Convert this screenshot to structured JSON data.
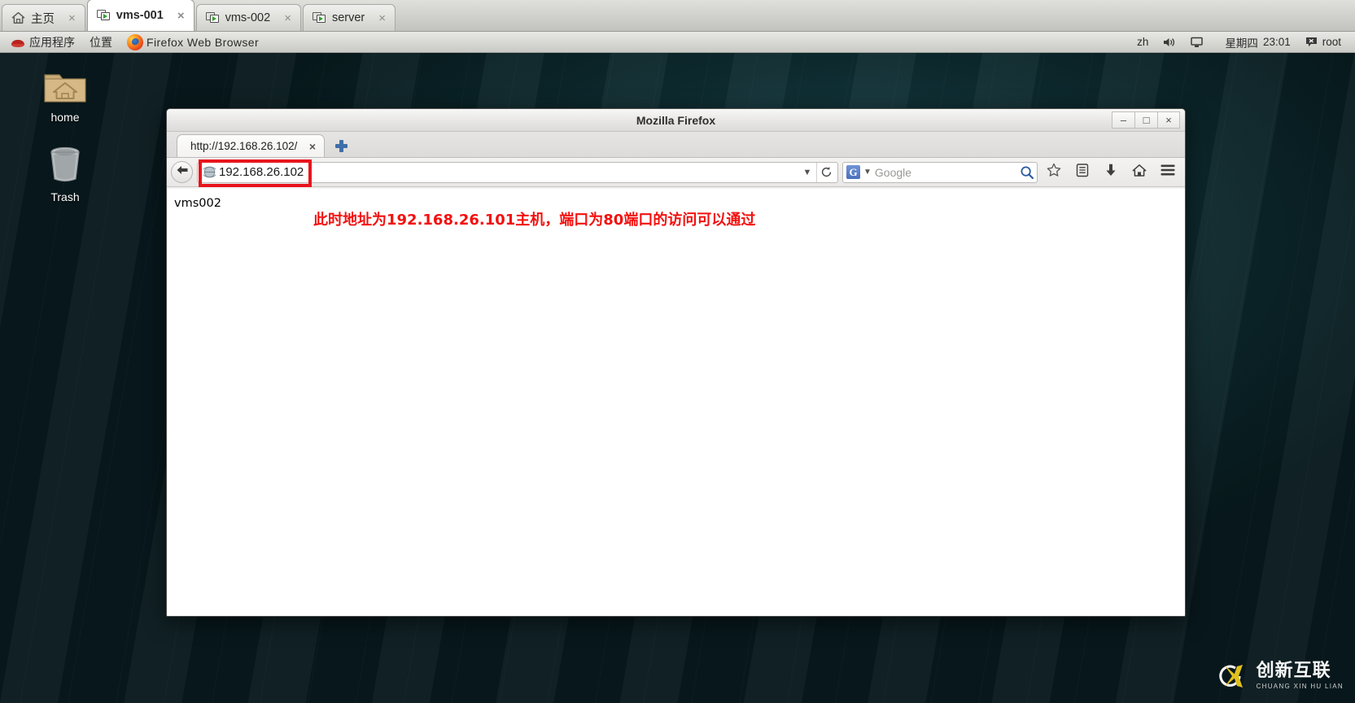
{
  "vm_tabs": [
    {
      "label": "主页",
      "icon": "home-icon",
      "active": false,
      "close": "×"
    },
    {
      "label": "vms-001",
      "icon": "vm-console-icon",
      "active": true,
      "close": "×"
    },
    {
      "label": "vms-002",
      "icon": "vm-console-icon",
      "active": false,
      "close": "×"
    },
    {
      "label": "server",
      "icon": "vm-console-icon",
      "active": false,
      "close": "×"
    }
  ],
  "panel": {
    "applications": "应用程序",
    "places": "位置",
    "firefox_label": "Firefox Web Browser",
    "input_method": "zh",
    "day": "星期四",
    "time": "23:01",
    "user": "root",
    "redhat_icon": "redhat-logo-icon",
    "firefox_icon": "firefox-logo-icon",
    "volume_icon": "speaker-icon",
    "display_icon": "display-icon",
    "user_icon": "user-status-icon"
  },
  "desktop": {
    "icons": [
      {
        "label": "home",
        "icon": "home-folder-icon"
      },
      {
        "label": "Trash",
        "icon": "trash-icon"
      }
    ]
  },
  "firefox": {
    "window_title": "Mozilla Firefox",
    "window_buttons": {
      "minimize": "–",
      "maximize": "□",
      "close": "×"
    },
    "tab": {
      "title": "http://192.168.26.102/",
      "close": "×"
    },
    "new_tab_icon": "new-tab-plus-icon",
    "back_icon": "back-arrow-icon",
    "url": {
      "value": "192.168.26.102",
      "icon": "globe-identity-icon",
      "dropdown_icon": "chevron-down-icon",
      "reload_icon": "reload-icon",
      "highlight_color": "#e8141c"
    },
    "search": {
      "engine": "Google",
      "engine_badge": "G",
      "placeholder": "Google",
      "chevron_icon": "chevron-down-icon",
      "go_icon": "search-magnifier-icon"
    },
    "toolbar_icons": [
      {
        "name": "bookmark-star-icon",
        "glyph": "☆"
      },
      {
        "name": "reading-list-icon",
        "glyph": "▤"
      },
      {
        "name": "downloads-icon",
        "glyph": "⬇"
      },
      {
        "name": "home-icon",
        "glyph": "⌂"
      },
      {
        "name": "hamburger-menu-icon",
        "glyph": "☰"
      }
    ],
    "page": {
      "body_text": "vms002",
      "annotation": "此时地址为192.168.26.101主机，端口为80端口的访问可以通过",
      "annotation_color": "#f3100f"
    }
  },
  "watermark": {
    "cn": "创新互联",
    "en": "CHUANG XIN HU LIAN",
    "mark_icon": "cx-logo-icon"
  }
}
